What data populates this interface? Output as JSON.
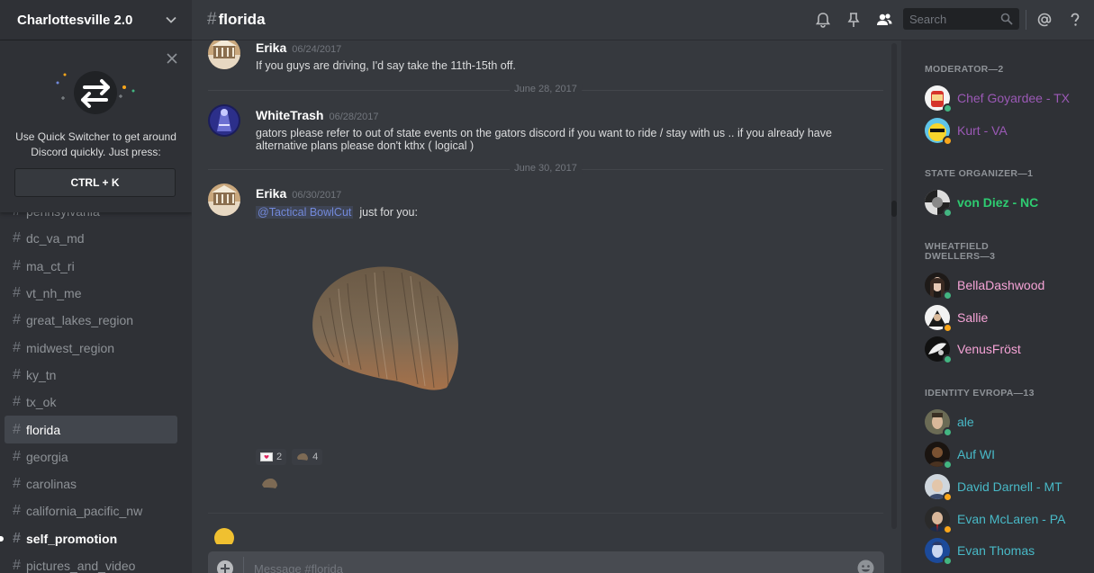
{
  "server": {
    "name": "Charlottesville 2.0"
  },
  "quick_switcher": {
    "description": "Use Quick Switcher to get around Discord quickly. Just press:",
    "shortcut": "CTRL + K"
  },
  "channels": [
    {
      "name": "pennsylvania",
      "state": "normal"
    },
    {
      "name": "dc_va_md",
      "state": "normal"
    },
    {
      "name": "ma_ct_ri",
      "state": "normal"
    },
    {
      "name": "vt_nh_me",
      "state": "normal"
    },
    {
      "name": "great_lakes_region",
      "state": "normal"
    },
    {
      "name": "midwest_region",
      "state": "normal"
    },
    {
      "name": "ky_tn",
      "state": "normal"
    },
    {
      "name": "tx_ok",
      "state": "normal"
    },
    {
      "name": "florida",
      "state": "active"
    },
    {
      "name": "georgia",
      "state": "normal"
    },
    {
      "name": "carolinas",
      "state": "normal"
    },
    {
      "name": "california_pacific_nw",
      "state": "normal"
    },
    {
      "name": "self_promotion",
      "state": "unread"
    },
    {
      "name": "pictures_and_video",
      "state": "normal"
    }
  ],
  "header": {
    "hash": "#",
    "channel": "florida",
    "search_placeholder": "Search"
  },
  "messages": [
    {
      "author": "Erika",
      "timestamp": "06/24/2017",
      "text": "If you guys are driving, I'd say take the 11th-15th off."
    },
    {
      "author": "WhiteTrash",
      "timestamp": "06/28/2017",
      "text": "gators please refer to out of state events on the gators discord if you want to ride / stay with us .. if you already have alternative plans please don't kthx ( logical )"
    },
    {
      "author": "Erika",
      "timestamp": "06/30/2017",
      "mention": "@Tactical BowlCut",
      "text": "just for you:"
    }
  ],
  "dividers": [
    "June 28, 2017",
    "June 30, 2017"
  ],
  "reactions": [
    {
      "emoji": "love-letter-icon",
      "count": "2"
    },
    {
      "emoji": "bowlcut-icon",
      "count": "4"
    }
  ],
  "composer": {
    "placeholder": "Message #florida"
  },
  "member_list": {
    "roles": [
      {
        "label": "MODERATOR—2"
      },
      {
        "label": "STATE ORGANIZER—1"
      },
      {
        "label": "WHEATFIELD DWELLERS—3"
      },
      {
        "label": "IDENTITY EVROPA—13"
      }
    ],
    "members": [
      {
        "name": "Chef Goyardee - TX",
        "color": "#9b59b6",
        "status": "online"
      },
      {
        "name": "Kurt - VA",
        "color": "#9b59b6",
        "status": "idle"
      },
      {
        "name": "von Diez - NC",
        "color": "#2ecc71",
        "status": "online"
      },
      {
        "name": "BellaDashwood",
        "color": "#f5a3d6",
        "status": "online"
      },
      {
        "name": "Sallie",
        "color": "#f5a3d6",
        "status": "idle"
      },
      {
        "name": "VenusFröst",
        "color": "#f5a3d6",
        "status": "online"
      },
      {
        "name": "ale",
        "color": "#48b9c7",
        "status": "online"
      },
      {
        "name": "Auf WI",
        "color": "#48b9c7",
        "status": "online"
      },
      {
        "name": "David Darnell - MT",
        "color": "#48b9c7",
        "status": "idle"
      },
      {
        "name": "Evan McLaren - PA",
        "color": "#48b9c7",
        "status": "idle"
      },
      {
        "name": "Evan Thomas",
        "color": "#48b9c7",
        "status": "online"
      }
    ]
  }
}
